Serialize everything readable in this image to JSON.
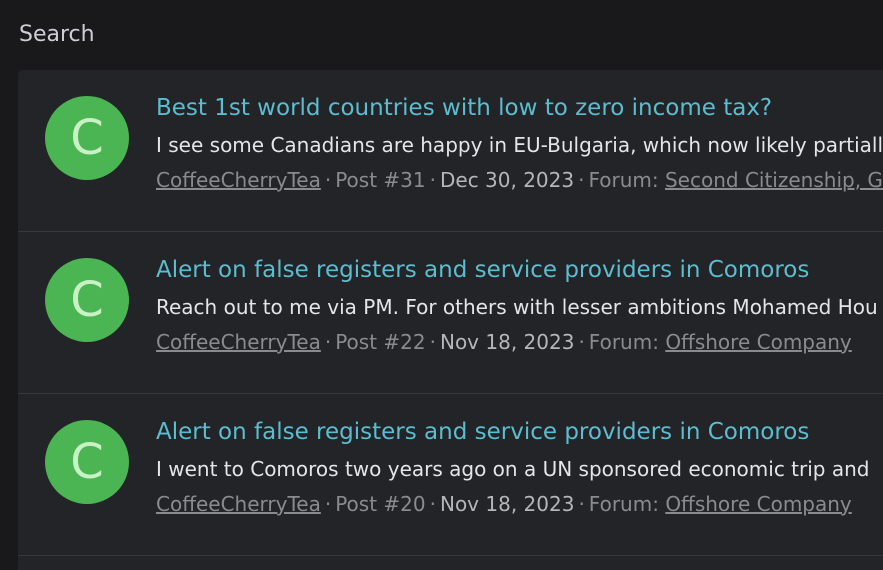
{
  "page": {
    "title": "Search"
  },
  "results": [
    {
      "avatar_letter": "C",
      "title": "Best 1st world countries with low to zero income tax?",
      "snippet": "I see some Canadians are happy in EU-Bulgaria, which now likely partially",
      "author": "CoffeeCherryTea",
      "post": "Post #31",
      "date": "Dec 30, 2023",
      "forum_prefix": "Forum:",
      "forum": "Second Citizenship, G"
    },
    {
      "avatar_letter": "C",
      "title": "Alert on false registers and service providers in Comoros",
      "snippet": "Reach out to me via PM. For others with lesser ambitions Mohamed Hou",
      "author": "CoffeeCherryTea",
      "post": "Post #22",
      "date": "Nov 18, 2023",
      "forum_prefix": "Forum:",
      "forum": "Offshore Company"
    },
    {
      "avatar_letter": "C",
      "title": "Alert on false registers and service providers in Comoros",
      "snippet": "I went to Comoros two years ago on a UN sponsored economic trip and",
      "author": "CoffeeCherryTea",
      "post": "Post #20",
      "date": "Nov 18, 2023",
      "forum_prefix": "Forum:",
      "forum": "Offshore Company"
    }
  ],
  "separator": "·"
}
